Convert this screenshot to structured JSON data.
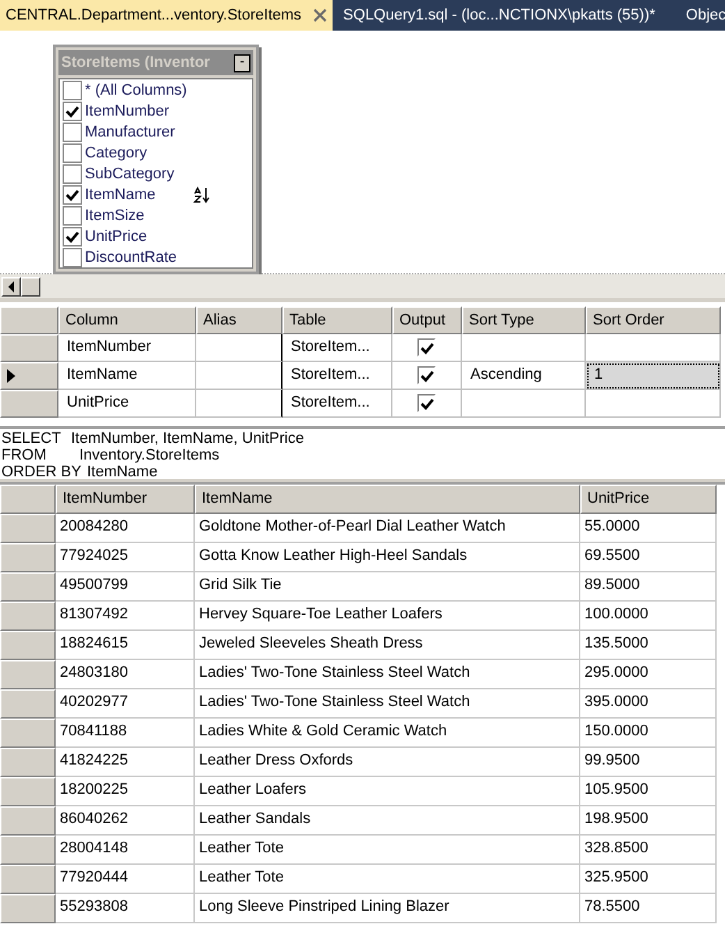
{
  "tabs": [
    {
      "label": "CENTRAL.Department...ventory.StoreItems",
      "selected": true
    },
    {
      "label": "SQLQuery1.sql - (loc...NCTIONX\\pkatts (55))*",
      "selected": false
    },
    {
      "label": "Objec",
      "selected": false
    }
  ],
  "diagram": {
    "table": {
      "title": "StoreItems (Inventor",
      "collapse": "-",
      "columns": [
        {
          "name": "* (All Columns)",
          "checked": false,
          "sorted": false
        },
        {
          "name": "ItemNumber",
          "checked": true,
          "sorted": false
        },
        {
          "name": "Manufacturer",
          "checked": false,
          "sorted": false
        },
        {
          "name": "Category",
          "checked": false,
          "sorted": false
        },
        {
          "name": "SubCategory",
          "checked": false,
          "sorted": false
        },
        {
          "name": "ItemName",
          "checked": true,
          "sorted": true
        },
        {
          "name": "ItemSize",
          "checked": false,
          "sorted": false
        },
        {
          "name": "UnitPrice",
          "checked": true,
          "sorted": false
        },
        {
          "name": "DiscountRate",
          "checked": false,
          "sorted": false
        }
      ]
    }
  },
  "criteria": {
    "columns": [
      "Column",
      "Alias",
      "Table",
      "Output",
      "Sort Type",
      "Sort Order"
    ],
    "rows": [
      {
        "column": "ItemNumber",
        "alias": "",
        "table": "StoreItem...",
        "output": true,
        "sort_type": "",
        "sort_order": "",
        "selected": false
      },
      {
        "column": "ItemName",
        "alias": "",
        "table": "StoreItem...",
        "output": true,
        "sort_type": "Ascending",
        "sort_order": "1",
        "selected": true
      },
      {
        "column": "UnitPrice",
        "alias": "",
        "table": "StoreItem...",
        "output": true,
        "sort_type": "",
        "sort_order": "",
        "selected": false
      }
    ]
  },
  "sql": [
    {
      "keyword": "SELECT",
      "text": "ItemNumber, ItemName, UnitPrice"
    },
    {
      "keyword": "FROM",
      "text": "Inventory.StoreItems"
    },
    {
      "keyword": "ORDER BY",
      "text": "ItemName"
    }
  ],
  "results": {
    "columns": [
      "ItemNumber",
      "ItemName",
      "UnitPrice"
    ],
    "rows": [
      [
        "20084280",
        "Goldtone Mother-of-Pearl Dial Leather Watch",
        "55.0000"
      ],
      [
        "77924025",
        "Gotta Know Leather High-Heel Sandals",
        "69.5500"
      ],
      [
        "49500799",
        "Grid Silk Tie",
        "89.5000"
      ],
      [
        "81307492",
        "Hervey Square-Toe Leather Loafers",
        "100.0000"
      ],
      [
        "18824615",
        "Jeweled Sleeveles Sheath Dress",
        "135.5000"
      ],
      [
        "24803180",
        "Ladies' Two-Tone Stainless Steel Watch",
        "295.0000"
      ],
      [
        "40202977",
        "Ladies' Two-Tone Stainless Steel Watch",
        "395.0000"
      ],
      [
        "70841188",
        "Ladies White & Gold Ceramic Watch",
        "150.0000"
      ],
      [
        "41824225",
        "Leather Dress Oxfords",
        "99.9500"
      ],
      [
        "18200225",
        "Leather Loafers",
        "105.9500"
      ],
      [
        "86040262",
        "Leather Sandals",
        "198.9500"
      ],
      [
        "28004148",
        "Leather Tote",
        "328.8500"
      ],
      [
        "77920444",
        "Leather Tote",
        "325.9500"
      ],
      [
        "55293808",
        "Long Sleeve Pinstriped Lining Blazer",
        "78.5500"
      ]
    ]
  }
}
